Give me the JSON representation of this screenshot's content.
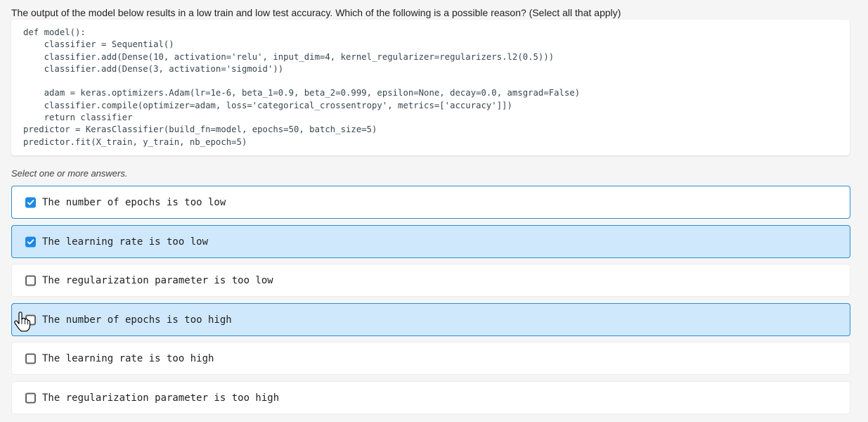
{
  "question": {
    "text": "The output of the model below results in a low train and low test accuracy. Which of the following is a possible reason? (Select all that apply)"
  },
  "code": {
    "lines": [
      "def model():",
      "    classifier = Sequential()",
      "    classifier.add(Dense(10, activation='relu', input_dim=4, kernel_regularizer=regularizers.l2(0.5)))",
      "    classifier.add(Dense(3, activation='sigmoid'))",
      "",
      "    adam = keras.optimizers.Adam(lr=1e-6, beta_1=0.9, beta_2=0.999, epsilon=None, decay=0.0, amsgrad=False)",
      "    classifier.compile(optimizer=adam, loss='categorical_crossentropy', metrics=['accuracy']])",
      "    return classifier",
      "predictor = KerasClassifier(build_fn=model, epochs=50, batch_size=5)",
      "predictor.fit(X_train, y_train, nb_epoch=5)"
    ]
  },
  "instruction": "Select one or more answers.",
  "options": [
    {
      "label": "The number of epochs is too low",
      "checked": true,
      "state": "outlined"
    },
    {
      "label": "The learning rate is too low",
      "checked": true,
      "state": "highlighted"
    },
    {
      "label": "The regularization parameter is too low",
      "checked": false,
      "state": "normal"
    },
    {
      "label": "The number of epochs is too high",
      "checked": false,
      "state": "highlighted"
    },
    {
      "label": "The learning rate is too high",
      "checked": false,
      "state": "normal"
    },
    {
      "label": "The regularization parameter is too high",
      "checked": false,
      "state": "normal"
    }
  ],
  "colors": {
    "accent": "#1e88e5",
    "highlight_bg": "#cfe8fb",
    "border": "#2a8fd6"
  },
  "cursor": "hand-pointer-icon"
}
